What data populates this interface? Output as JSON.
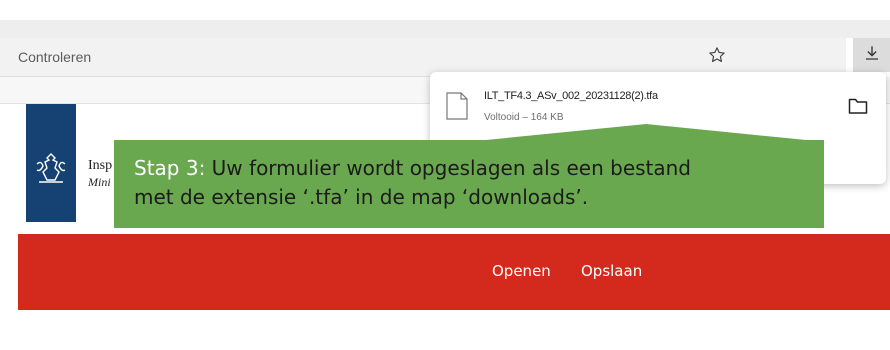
{
  "address_bar": {
    "text": "Controleren"
  },
  "site": {
    "line1": "Insp",
    "line2": "Mini"
  },
  "downloads": {
    "file_name": "ILT_TF4.3_ASv_002_20231128(2).tfa",
    "status": "Voltooid – 164 KB"
  },
  "callout": {
    "step_label": "Stap 3:",
    "text_line1": " Uw formulier wordt opgeslagen als een bestand",
    "text_line2": "met de extensie ‘.tfa’ in de map ‘downloads’."
  },
  "actions": {
    "open_label": "Openen",
    "save_label": "Opslaan"
  },
  "colors": {
    "callout_bg": "#6aa84f",
    "red_bar": "#d42a1e",
    "logo_blue": "#154273"
  },
  "icons": [
    "star-icon",
    "download-icon",
    "file-icon",
    "folder-icon",
    "emblem-icon"
  ]
}
